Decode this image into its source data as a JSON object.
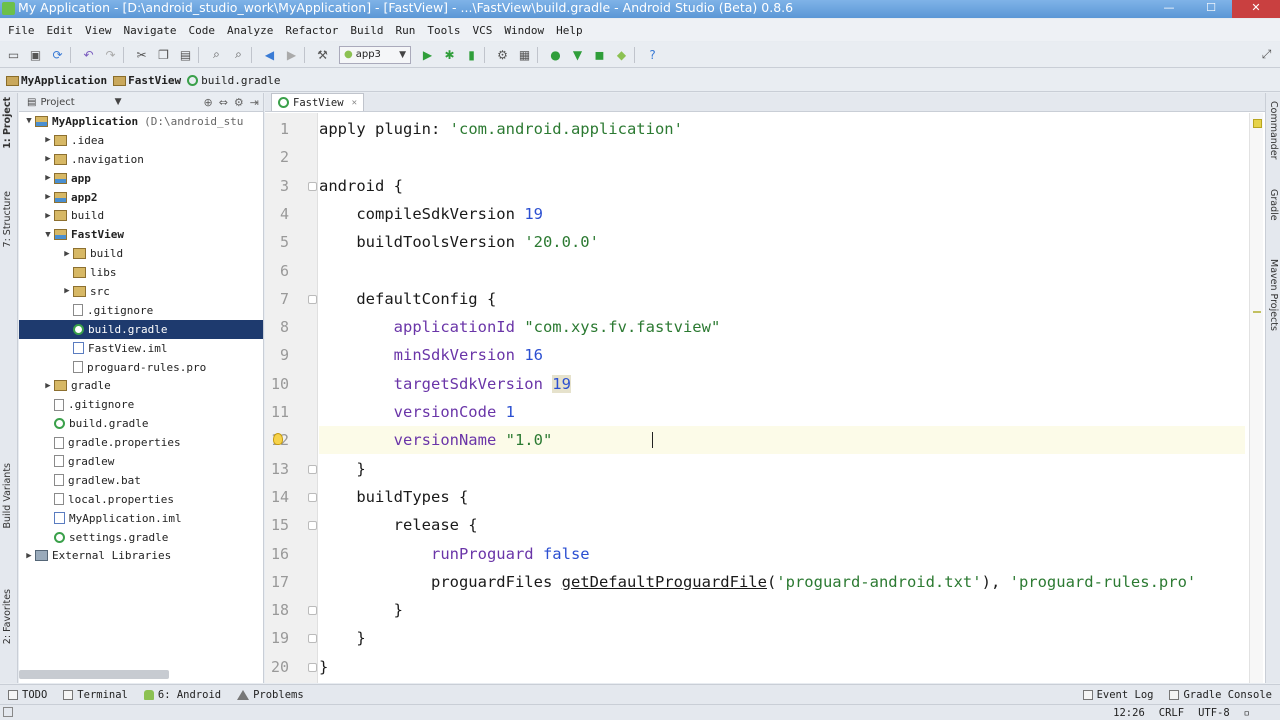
{
  "window": {
    "title": "My Application - [D:\\android_studio_work\\MyApplication] - [FastView] - ...\\FastView\\build.gradle - Android Studio (Beta) 0.8.6",
    "minimize": "—",
    "maximize": "☐",
    "close": "✕"
  },
  "menu": [
    "File",
    "Edit",
    "View",
    "Navigate",
    "Code",
    "Analyze",
    "Refactor",
    "Build",
    "Run",
    "Tools",
    "VCS",
    "Window",
    "Help"
  ],
  "toolbar": {
    "run_config": "app3"
  },
  "breadcrumb": [
    "MyApplication",
    "FastView",
    "build.gradle"
  ],
  "left_tabs": [
    "1: Project",
    "7: Structure",
    "Build Variants",
    "2: Favorites"
  ],
  "right_tabs": [
    "Commander",
    "Gradle",
    "Maven Projects"
  ],
  "project_panel": {
    "header": "Project",
    "tree": [
      {
        "label": "MyApplication",
        "path": "(D:\\android_stu",
        "icon": "module",
        "depth": 0,
        "expanded": true,
        "bold": true
      },
      {
        "label": ".idea",
        "icon": "folder",
        "depth": 1,
        "collapsed": true
      },
      {
        "label": ".navigation",
        "icon": "folder",
        "depth": 1,
        "collapsed": true
      },
      {
        "label": "app",
        "icon": "module",
        "depth": 1,
        "collapsed": true,
        "bold": true
      },
      {
        "label": "app2",
        "icon": "module",
        "depth": 1,
        "collapsed": true,
        "bold": true
      },
      {
        "label": "build",
        "icon": "folder",
        "depth": 1,
        "collapsed": true
      },
      {
        "label": "FastView",
        "icon": "module",
        "depth": 1,
        "expanded": true,
        "bold": true
      },
      {
        "label": "build",
        "icon": "folder",
        "depth": 2,
        "collapsed": true
      },
      {
        "label": "libs",
        "icon": "folder",
        "depth": 2
      },
      {
        "label": "src",
        "icon": "folder",
        "depth": 2,
        "collapsed": true
      },
      {
        "label": ".gitignore",
        "icon": "file",
        "depth": 2
      },
      {
        "label": "build.gradle",
        "icon": "gradle",
        "depth": 2,
        "selected": true
      },
      {
        "label": "FastView.iml",
        "icon": "iml",
        "depth": 2
      },
      {
        "label": "proguard-rules.pro",
        "icon": "file",
        "depth": 2
      },
      {
        "label": "gradle",
        "icon": "folder",
        "depth": 1,
        "collapsed": true
      },
      {
        "label": ".gitignore",
        "icon": "file",
        "depth": 1
      },
      {
        "label": "build.gradle",
        "icon": "gradle",
        "depth": 1
      },
      {
        "label": "gradle.properties",
        "icon": "file",
        "depth": 1
      },
      {
        "label": "gradlew",
        "icon": "file",
        "depth": 1
      },
      {
        "label": "gradlew.bat",
        "icon": "file",
        "depth": 1
      },
      {
        "label": "local.properties",
        "icon": "file",
        "depth": 1
      },
      {
        "label": "MyApplication.iml",
        "icon": "iml",
        "depth": 1
      },
      {
        "label": "settings.gradle",
        "icon": "gradle",
        "depth": 1
      },
      {
        "label": "External Libraries",
        "icon": "libs",
        "depth": 0,
        "collapsed": true
      }
    ]
  },
  "editor": {
    "tab": "FastView",
    "tab_close": "✕",
    "lines": [
      {
        "n": "1",
        "t": [
          [
            "kw",
            "apply plugin: "
          ],
          [
            "s",
            "'com.android.application'"
          ]
        ]
      },
      {
        "n": "2",
        "t": []
      },
      {
        "n": "3",
        "t": [
          [
            "kw",
            "android {"
          ]
        ]
      },
      {
        "n": "4",
        "t": [
          [
            "kw",
            "    compileSdkVersion "
          ],
          [
            "num",
            "19"
          ]
        ]
      },
      {
        "n": "5",
        "t": [
          [
            "kw",
            "    buildToolsVersion "
          ],
          [
            "s",
            "'20.0.0'"
          ]
        ]
      },
      {
        "n": "6",
        "t": []
      },
      {
        "n": "7",
        "t": [
          [
            "kw",
            "    defaultConfig {"
          ]
        ]
      },
      {
        "n": "8",
        "t": [
          [
            "prop",
            "        applicationId "
          ],
          [
            "s",
            "\"com.xys.fv.fastview\""
          ]
        ]
      },
      {
        "n": "9",
        "t": [
          [
            "prop",
            "        minSdkVersion "
          ],
          [
            "num",
            "16"
          ]
        ]
      },
      {
        "n": "10",
        "t": [
          [
            "prop",
            "        targetSdkVersion "
          ],
          [
            "numhl",
            "19"
          ]
        ]
      },
      {
        "n": "11",
        "t": [
          [
            "prop",
            "        versionCode "
          ],
          [
            "num",
            "1"
          ]
        ]
      },
      {
        "n": "12",
        "t": [
          [
            "prop",
            "        versionName "
          ],
          [
            "s",
            "\"1.0\""
          ]
        ]
      },
      {
        "n": "13",
        "t": [
          [
            "kw",
            "    }"
          ]
        ]
      },
      {
        "n": "14",
        "t": [
          [
            "kw",
            "    buildTypes {"
          ]
        ]
      },
      {
        "n": "15",
        "t": [
          [
            "kw",
            "        release {"
          ]
        ]
      },
      {
        "n": "16",
        "t": [
          [
            "prop",
            "            runProguard "
          ],
          [
            "num",
            "false"
          ]
        ]
      },
      {
        "n": "17",
        "t": [
          [
            "kw",
            "            proguardFiles "
          ],
          [
            "fn",
            "getDefaultProguardFile"
          ],
          [
            "kw",
            "("
          ],
          [
            "s",
            "'proguard-android.txt'"
          ],
          [
            "kw",
            "), "
          ],
          [
            "s",
            "'proguard-rules.pro'"
          ]
        ]
      },
      {
        "n": "18",
        "t": [
          [
            "kw",
            "        }"
          ]
        ]
      },
      {
        "n": "19",
        "t": [
          [
            "kw",
            "    }"
          ]
        ]
      },
      {
        "n": "20",
        "t": [
          [
            "kw",
            "}"
          ]
        ]
      }
    ]
  },
  "bottom_tools": {
    "left": [
      "TODO",
      "Terminal",
      "6: Android",
      "Problems"
    ],
    "right": [
      "Event Log",
      "Gradle Console"
    ]
  },
  "status": {
    "position": "12:26",
    "line_sep": "CRLF",
    "encoding": "UTF-8"
  }
}
